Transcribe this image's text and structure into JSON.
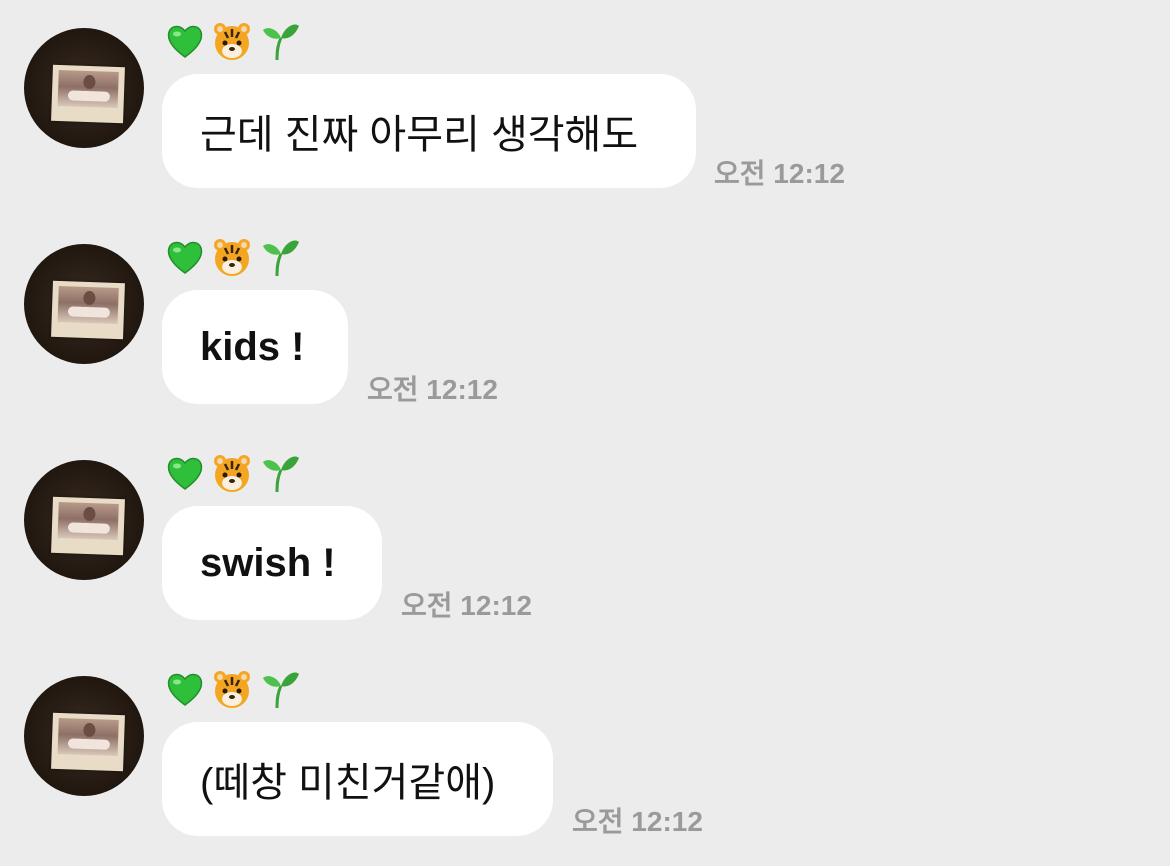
{
  "chat": {
    "sender": {
      "display_icons": [
        "green-heart-icon",
        "tiger-face-icon",
        "seedling-icon"
      ],
      "avatar": "polaroid-photo-avatar"
    },
    "messages": [
      {
        "text": "근데 진짜 아무리 생각해도",
        "time": "오전 12:12"
      },
      {
        "text": "kids !",
        "time": "오전 12:12"
      },
      {
        "text": "swish !",
        "time": "오전 12:12"
      },
      {
        "text": "(떼창 미친거같애)",
        "time": "오전 12:12"
      }
    ]
  },
  "colors": {
    "background": "#ececec",
    "bubble": "#ffffff",
    "timestamp": "#9a9a9a",
    "heart": "#2fbf3a",
    "tiger": "#f4a623",
    "sprout": "#3aa33a"
  }
}
